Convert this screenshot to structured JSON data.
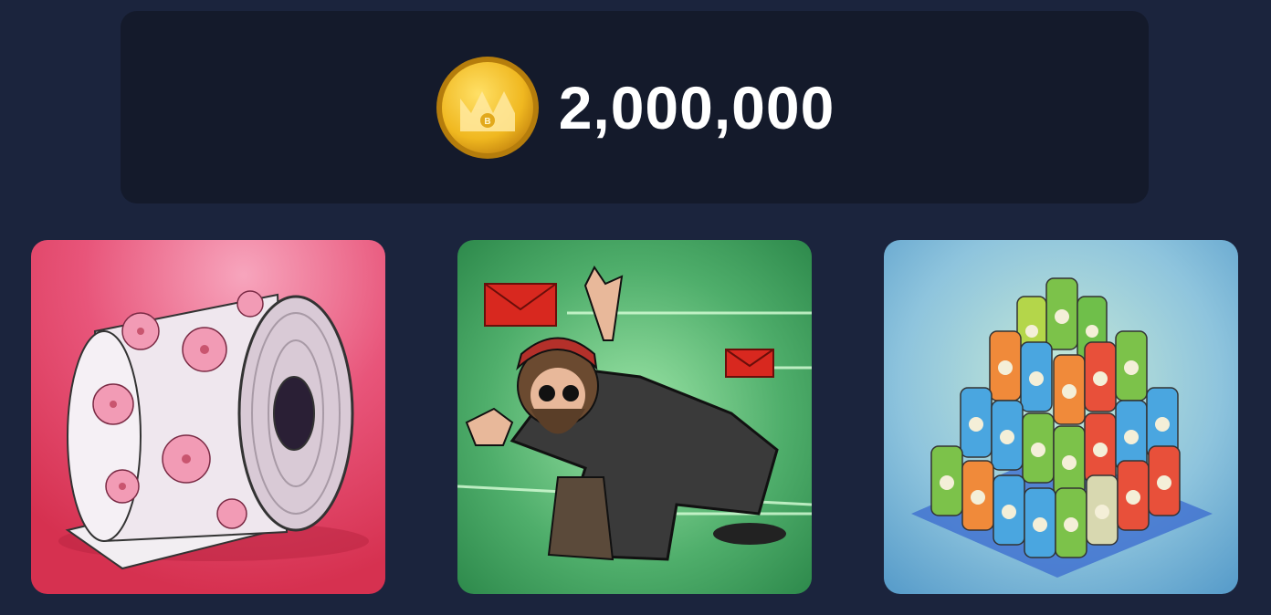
{
  "reward": {
    "amount": "2,000,000",
    "icon": "crown-coin-icon",
    "coin_color": "#f2c230"
  },
  "cards": [
    {
      "name": "toilet-paper-roll",
      "icon": "toilet-paper-icon",
      "background": "#e0405f"
    },
    {
      "name": "bearded-hacker",
      "icon": "hacker-dodging-envelopes-icon",
      "background": "#4fae6b"
    },
    {
      "name": "soda-can-pyramid",
      "icon": "can-pyramid-icon",
      "background": "#6fb0d8"
    }
  ]
}
